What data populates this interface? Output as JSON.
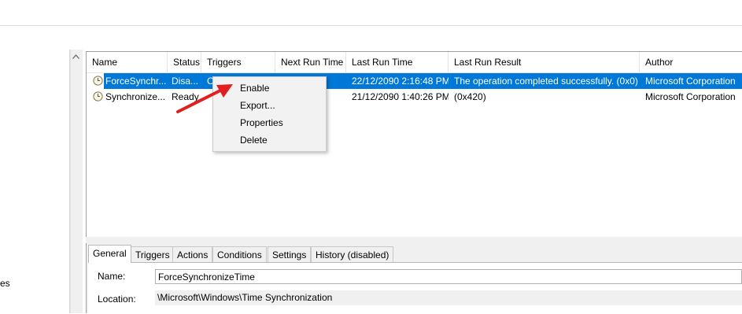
{
  "columns": [
    "Name",
    "Status",
    "Triggers",
    "Next Run Time",
    "Last Run Time",
    "Last Run Result",
    "Author"
  ],
  "tasks": [
    {
      "name": "ForceSynchr...",
      "status": "Disa...",
      "triggers": "C",
      "next_run": "",
      "last_run": "22/12/2090 2:16:48 PM",
      "result": "The operation completed successfully. (0x0)",
      "author": "Microsoft Corporation",
      "selected": true
    },
    {
      "name": "Synchronize...",
      "status": "Ready",
      "triggers": "",
      "next_run": "",
      "last_run": "21/12/2090 1:40:26 PM",
      "result": "(0x420)",
      "author": "Microsoft Corporation",
      "selected": false
    }
  ],
  "context_menu": [
    "Enable",
    "Export...",
    "Properties",
    "Delete"
  ],
  "tabs": [
    "General",
    "Triggers",
    "Actions",
    "Conditions",
    "Settings",
    "History (disabled)"
  ],
  "general": {
    "name_label": "Name:",
    "name_value": "ForceSynchronizeTime",
    "location_label": "Location:",
    "location_value": "\\Microsoft\\Windows\\Time Synchronization"
  },
  "left_pane_text": "es",
  "icons": {
    "task": "clock-icon",
    "scroll_up": "chevron-up-icon",
    "annotation": "red-arrow"
  },
  "colors": {
    "selection": "#0078d7",
    "annotation_arrow": "#e02020"
  }
}
